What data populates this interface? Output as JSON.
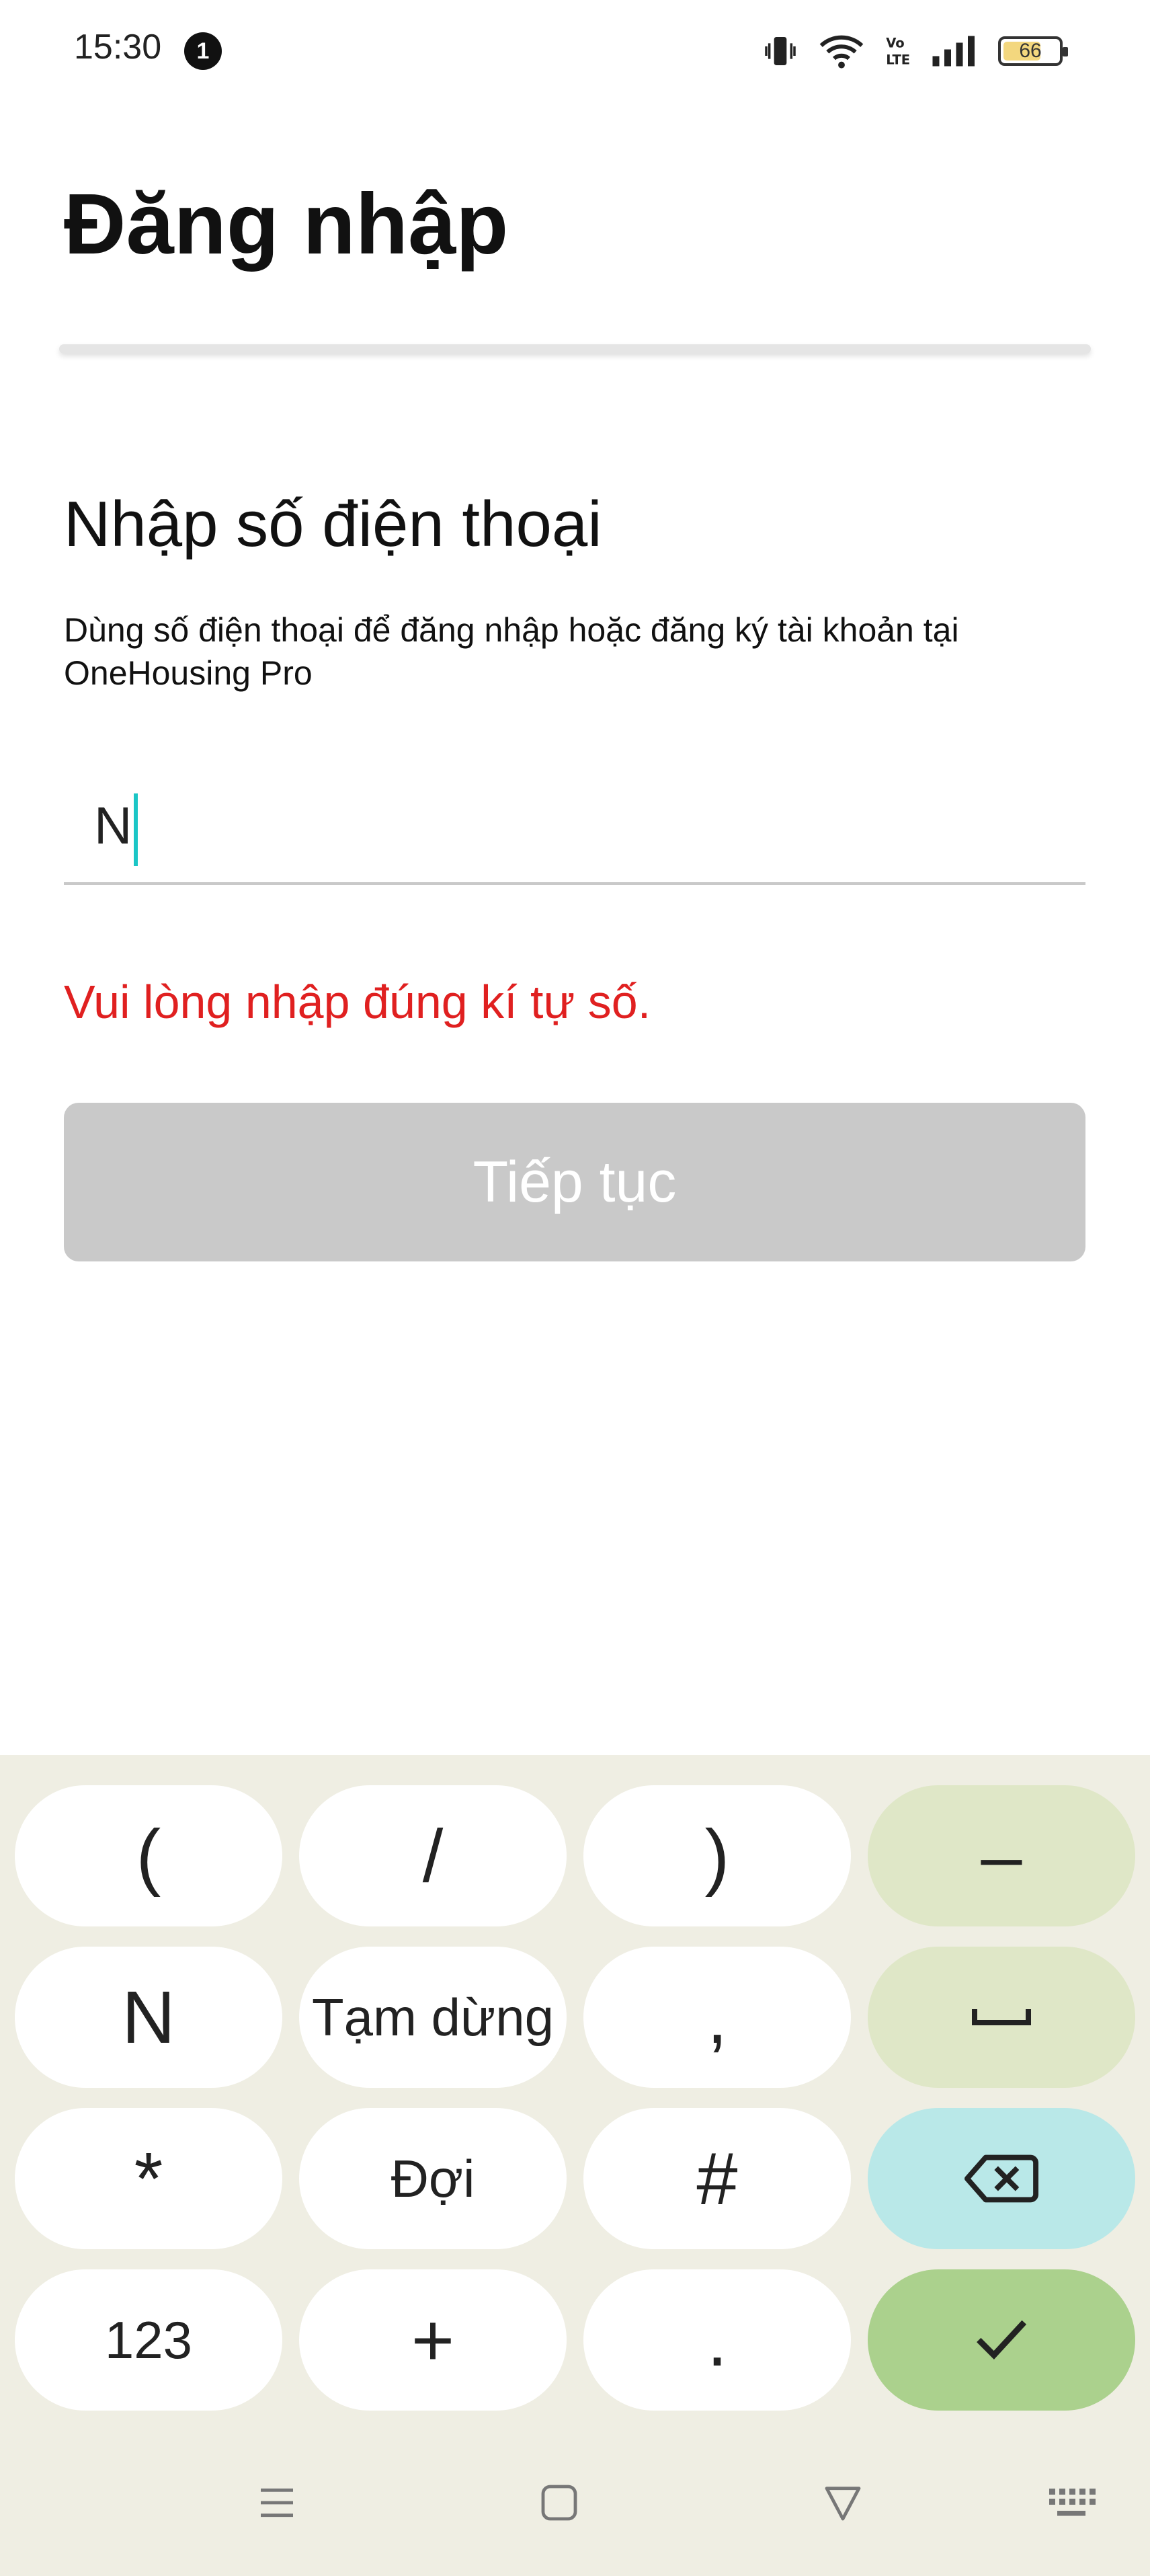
{
  "status_bar": {
    "time": "15:30",
    "notification_count": "1",
    "battery_level": "66",
    "icons": [
      "vibrate-icon",
      "wifi-icon",
      "volte-icon",
      "signal-icon",
      "battery-icon"
    ]
  },
  "header": {
    "title": "Đăng nhập"
  },
  "form": {
    "section_title": "Nhập số điện thoại",
    "description": "Dùng số điện thoại để đăng nhập hoặc đăng ký tài khoản tại OneHousing Pro",
    "phone_value": "N",
    "error_message": "Vui lòng nhập đúng kí tự số.",
    "continue_label": "Tiếp tục"
  },
  "keyboard": {
    "rows": [
      [
        "(",
        "/",
        ")",
        "–"
      ],
      [
        "N",
        "Tạm dừng",
        ",",
        "space"
      ],
      [
        "*",
        "Đợi",
        "#",
        "backspace"
      ],
      [
        "123",
        "+",
        ".",
        "done"
      ]
    ],
    "key_open_paren": "(",
    "key_slash": "/",
    "key_close_paren": ")",
    "key_dash": "–",
    "key_n": "N",
    "key_pause": "Tạm dừng",
    "key_comma": ",",
    "key_star": "*",
    "key_wait": "Đợi",
    "key_hash": "#",
    "key_123": "123",
    "key_plus": "+",
    "key_dot": "."
  },
  "colors": {
    "error": "#e02020",
    "button_disabled": "#c9c9c9",
    "caret": "#1bc6c6",
    "keyboard_bg": "#efeee3",
    "key_action": "#dfe7c7",
    "key_backspace": "#b9e8e8",
    "key_done": "#abd18d"
  }
}
